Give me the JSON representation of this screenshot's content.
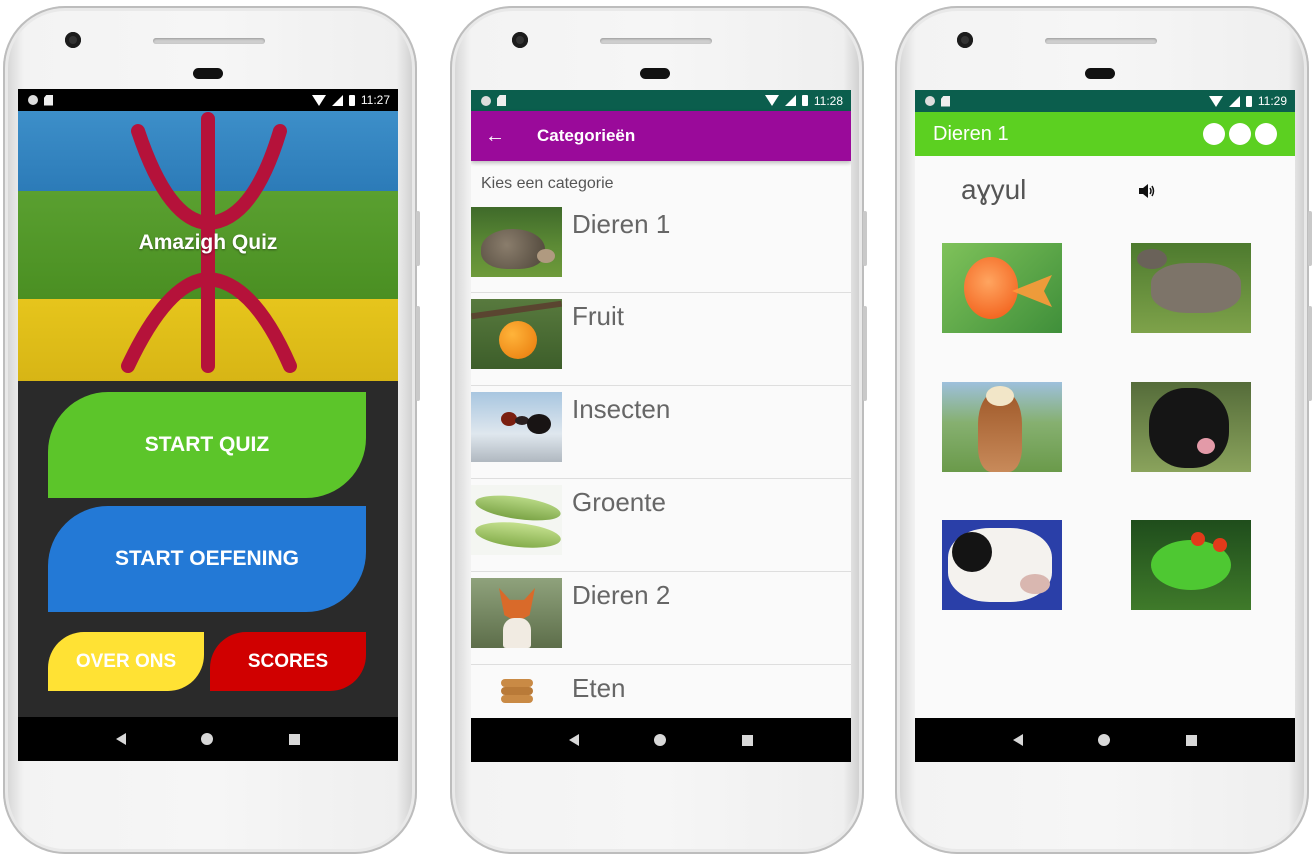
{
  "screen1": {
    "status": {
      "time": "11:27"
    },
    "app_title": "Amazigh Quiz",
    "buttons": {
      "start_quiz": "START QUIZ",
      "start_practice": "START OEFENING",
      "about": "OVER ONS",
      "scores": "SCORES"
    },
    "colors": {
      "status_bar": "#000000",
      "start_quiz": "#5cc52a",
      "start_practice": "#2379d6",
      "about": "#ffe234",
      "scores": "#d00000",
      "menu_bg": "#2a2a2a"
    }
  },
  "screen2": {
    "status": {
      "time": "11:28"
    },
    "toolbar_title": "Categorieën",
    "subtitle": "Kies een categorie",
    "categories": [
      {
        "label": "Dieren 1",
        "icon": "hedgehog-image"
      },
      {
        "label": "Fruit",
        "icon": "orange-image"
      },
      {
        "label": "Insecten",
        "icon": "ant-image"
      },
      {
        "label": "Groente",
        "icon": "peas-image"
      },
      {
        "label": "Dieren 2",
        "icon": "fox-image"
      },
      {
        "label": "Eten",
        "icon": "cookies-image"
      }
    ],
    "colors": {
      "status_bar": "#0b5e4d",
      "toolbar": "#9a0a9a"
    }
  },
  "screen3": {
    "status": {
      "time": "11:29"
    },
    "toolbar_title": "Dieren 1",
    "word": "aɣyul",
    "answers": [
      "goldfish-image",
      "donkey-image",
      "horse-image",
      "dog-image",
      "cow-image",
      "frog-image"
    ],
    "colors": {
      "status_bar": "#0b5e4d",
      "toolbar": "#5cd021"
    }
  }
}
